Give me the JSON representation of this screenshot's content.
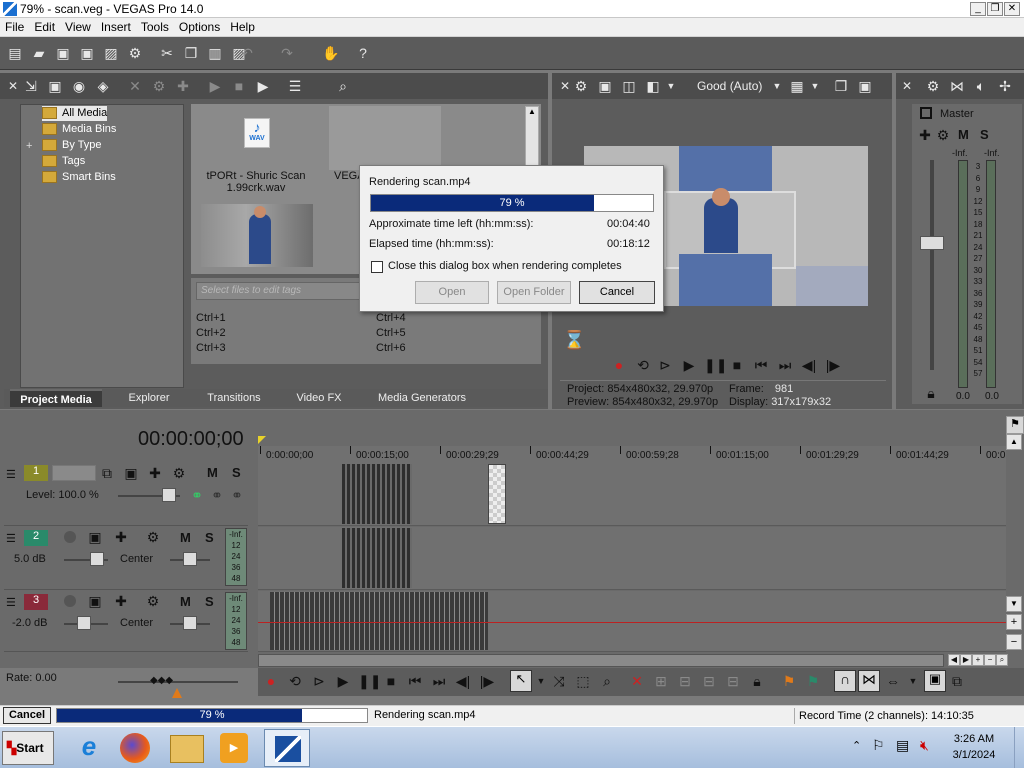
{
  "window": {
    "title": "79% - scan.veg - VEGAS Pro 14.0",
    "min": "_",
    "max": "❐",
    "close": "✕"
  },
  "menu": [
    "File",
    "Edit",
    "View",
    "Insert",
    "Tools",
    "Options",
    "Help"
  ],
  "explorer": {
    "tree": [
      {
        "label": "All Media"
      },
      {
        "label": "Media Bins"
      },
      {
        "label": "By Type",
        "expander": "+"
      },
      {
        "label": "Tags"
      },
      {
        "label": "Smart Bins"
      }
    ],
    "media": [
      {
        "name": "tPORt - Shuric Scan 1.99crk.wav",
        "badge": "WAV"
      },
      {
        "name": "VEGA"
      }
    ],
    "tag_placeholder": "Select files to edit tags",
    "shortcuts": [
      "Ctrl+1",
      "Ctrl+2",
      "Ctrl+3",
      "Ctrl+4",
      "Ctrl+5",
      "Ctrl+6"
    ],
    "tabs": [
      "Project Media",
      "Explorer",
      "Transitions",
      "Video FX",
      "Media Generators"
    ]
  },
  "preview": {
    "quality": "Good (Auto)",
    "project_label": "Project:",
    "project_value": "854x480x32, 29.970p",
    "preview_label": "Preview:",
    "preview_value": "854x480x32, 29.970p",
    "frame_label": "Frame:",
    "frame_value": "981",
    "display_label": "Display:",
    "display_value": "317x179x32"
  },
  "mixer": {
    "title": "Master",
    "m": "M",
    "s": "S",
    "inf_left": "-Inf.",
    "inf_right": "-Inf.",
    "scale": [
      "3",
      "6",
      "9",
      "12",
      "15",
      "18",
      "21",
      "24",
      "27",
      "30",
      "33",
      "36",
      "39",
      "42",
      "45",
      "48",
      "51",
      "54",
      "57"
    ],
    "bottom_left": "0.0",
    "bottom_right": "0.0"
  },
  "timeline": {
    "timecode": "00:00:00;00",
    "ruler": [
      "0:00:00;00",
      "00:00:15;00",
      "00:00:29;29",
      "00:00:44;29",
      "00:00:59;28",
      "00:01:15;00",
      "00:01:29;29",
      "00:01:44;29",
      "00:0"
    ],
    "tracks": [
      {
        "num": "1",
        "level": "Level: 100.0 %",
        "m": "M",
        "s": "S",
        "color": "#8a8a2a"
      },
      {
        "num": "2",
        "vol": "5.0 dB",
        "pan": "Center",
        "m": "M",
        "s": "S",
        "color": "#2a8a6a",
        "meter": [
          "-Inf.",
          "12",
          "24",
          "36",
          "48"
        ]
      },
      {
        "num": "3",
        "vol": "-2.0 dB",
        "pan": "Center",
        "m": "M",
        "s": "S",
        "color": "#8a2a3a",
        "meter": [
          "-Inf.",
          "12",
          "24",
          "36",
          "48"
        ]
      }
    ],
    "rate": "Rate: 0.00"
  },
  "dialog": {
    "title": "Rendering scan.mp4",
    "progress": 79,
    "progress_label": "79 %",
    "time_left_label": "Approximate time left (hh:mm:ss):",
    "time_left": "00:04:40",
    "elapsed_label": "Elapsed time (hh:mm:ss):",
    "elapsed": "00:18:12",
    "checkbox_label": "Close this dialog box when rendering completes",
    "open": "Open",
    "open_folder": "Open Folder",
    "cancel": "Cancel"
  },
  "status": {
    "cancel": "Cancel",
    "progress": 79,
    "progress_label": "79 %",
    "message": "Rendering scan.mp4",
    "record_time": "Record Time (2 channels): 14:10:35"
  },
  "taskbar": {
    "start": "Start",
    "time": "3:26 AM",
    "date": "3/1/2024"
  }
}
